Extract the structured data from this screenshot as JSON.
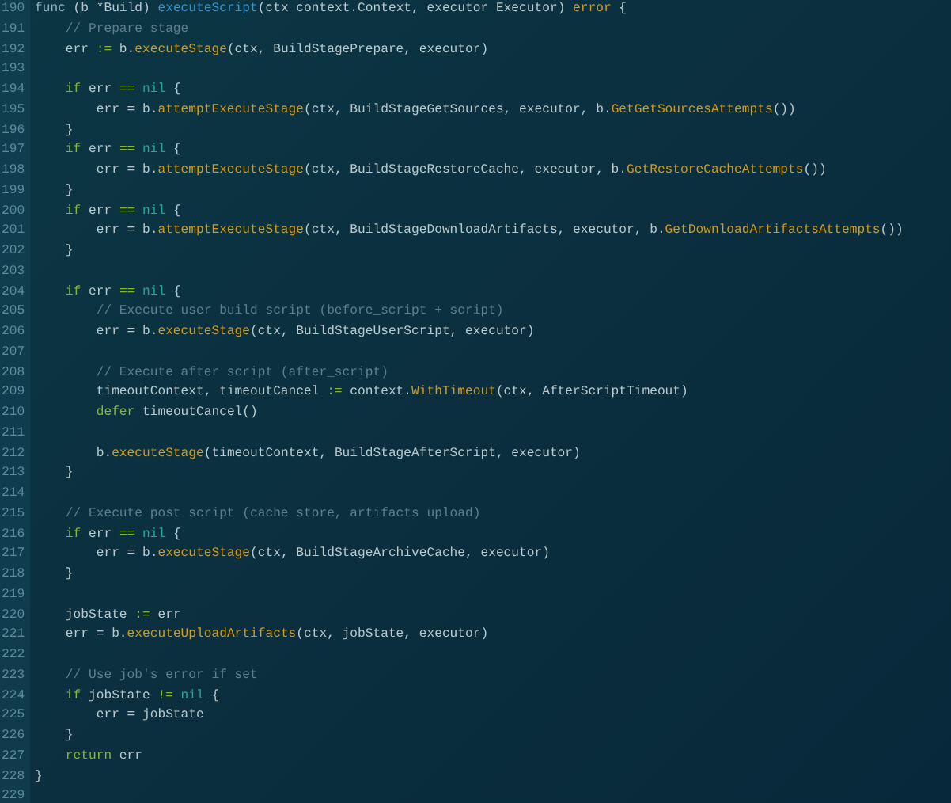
{
  "editor": {
    "lines": [
      {
        "number": "190",
        "tokens": [
          {
            "kind": "decl",
            "text": "func"
          },
          {
            "kind": "txt",
            "text": " (b *Build) "
          },
          {
            "kind": "def",
            "text": "executeScript"
          },
          {
            "kind": "txt",
            "text": "(ctx context.Context, executor Executor) "
          },
          {
            "kind": "type",
            "text": "error"
          },
          {
            "kind": "txt",
            "text": " {"
          }
        ]
      },
      {
        "number": "191",
        "tokens": [
          {
            "kind": "cmt",
            "text": "    // Prepare stage"
          }
        ]
      },
      {
        "number": "192",
        "tokens": [
          {
            "kind": "txt",
            "text": "    err "
          },
          {
            "kind": "op",
            "text": ":="
          },
          {
            "kind": "txt",
            "text": " b."
          },
          {
            "kind": "call",
            "text": "executeStage"
          },
          {
            "kind": "txt",
            "text": "(ctx, BuildStagePrepare, executor)"
          }
        ]
      },
      {
        "number": "193"
      },
      {
        "number": "194",
        "tokens": [
          {
            "kind": "kw",
            "text": "    if"
          },
          {
            "kind": "txt",
            "text": " err "
          },
          {
            "kind": "op",
            "text": "=="
          },
          {
            "kind": "nil",
            "text": " nil"
          },
          {
            "kind": "txt",
            "text": " {"
          }
        ]
      },
      {
        "number": "195",
        "tokens": [
          {
            "kind": "txt",
            "text": "        err = b."
          },
          {
            "kind": "call",
            "text": "attemptExecuteStage"
          },
          {
            "kind": "txt",
            "text": "(ctx, BuildStageGetSources, executor, b."
          },
          {
            "kind": "call",
            "text": "GetGetSourcesAttempts"
          },
          {
            "kind": "txt",
            "text": "())"
          }
        ]
      },
      {
        "number": "196",
        "tokens": [
          {
            "kind": "txt",
            "text": "    }"
          }
        ]
      },
      {
        "number": "197",
        "tokens": [
          {
            "kind": "kw",
            "text": "    if"
          },
          {
            "kind": "txt",
            "text": " err "
          },
          {
            "kind": "op",
            "text": "=="
          },
          {
            "kind": "nil",
            "text": " nil"
          },
          {
            "kind": "txt",
            "text": " {"
          }
        ]
      },
      {
        "number": "198",
        "tokens": [
          {
            "kind": "txt",
            "text": "        err = b."
          },
          {
            "kind": "call",
            "text": "attemptExecuteStage"
          },
          {
            "kind": "txt",
            "text": "(ctx, BuildStageRestoreCache, executor, b."
          },
          {
            "kind": "call",
            "text": "GetRestoreCacheAttempts"
          },
          {
            "kind": "txt",
            "text": "())"
          }
        ]
      },
      {
        "number": "199",
        "tokens": [
          {
            "kind": "txt",
            "text": "    }"
          }
        ]
      },
      {
        "number": "200",
        "tokens": [
          {
            "kind": "kw",
            "text": "    if"
          },
          {
            "kind": "txt",
            "text": " err "
          },
          {
            "kind": "op",
            "text": "=="
          },
          {
            "kind": "nil",
            "text": " nil"
          },
          {
            "kind": "txt",
            "text": " {"
          }
        ]
      },
      {
        "number": "201",
        "tokens": [
          {
            "kind": "txt",
            "text": "        err = b."
          },
          {
            "kind": "call",
            "text": "attemptExecuteStage"
          },
          {
            "kind": "txt",
            "text": "(ctx, BuildStageDownloadArtifacts, executor, b."
          },
          {
            "kind": "call",
            "text": "GetDownloadArtifactsAttempts"
          },
          {
            "kind": "txt",
            "text": "())"
          }
        ]
      },
      {
        "number": "202",
        "tokens": [
          {
            "kind": "txt",
            "text": "    }"
          }
        ]
      },
      {
        "number": "203"
      },
      {
        "number": "204",
        "tokens": [
          {
            "kind": "kw",
            "text": "    if"
          },
          {
            "kind": "txt",
            "text": " err "
          },
          {
            "kind": "op",
            "text": "=="
          },
          {
            "kind": "nil",
            "text": " nil"
          },
          {
            "kind": "txt",
            "text": " {"
          }
        ]
      },
      {
        "number": "205",
        "tokens": [
          {
            "kind": "cmt",
            "text": "        // Execute user build script (before_script + script)"
          }
        ]
      },
      {
        "number": "206",
        "tokens": [
          {
            "kind": "txt",
            "text": "        err = b."
          },
          {
            "kind": "call",
            "text": "executeStage"
          },
          {
            "kind": "txt",
            "text": "(ctx, BuildStageUserScript, executor)"
          }
        ]
      },
      {
        "number": "207"
      },
      {
        "number": "208",
        "tokens": [
          {
            "kind": "cmt",
            "text": "        // Execute after script (after_script)"
          }
        ]
      },
      {
        "number": "209",
        "tokens": [
          {
            "kind": "txt",
            "text": "        timeoutContext, timeoutCancel "
          },
          {
            "kind": "op",
            "text": ":="
          },
          {
            "kind": "txt",
            "text": " context."
          },
          {
            "kind": "call",
            "text": "WithTimeout"
          },
          {
            "kind": "txt",
            "text": "(ctx, AfterScriptTimeout)"
          }
        ]
      },
      {
        "number": "210",
        "tokens": [
          {
            "kind": "kw",
            "text": "        defer"
          },
          {
            "kind": "txt",
            "text": " timeoutCancel()"
          }
        ]
      },
      {
        "number": "211"
      },
      {
        "number": "212",
        "tokens": [
          {
            "kind": "txt",
            "text": "        b."
          },
          {
            "kind": "call",
            "text": "executeStage"
          },
          {
            "kind": "txt",
            "text": "(timeoutContext, BuildStageAfterScript, executor)"
          }
        ]
      },
      {
        "number": "213",
        "tokens": [
          {
            "kind": "txt",
            "text": "    }"
          }
        ]
      },
      {
        "number": "214"
      },
      {
        "number": "215",
        "tokens": [
          {
            "kind": "cmt",
            "text": "    // Execute post script (cache store, artifacts upload)"
          }
        ]
      },
      {
        "number": "216",
        "tokens": [
          {
            "kind": "kw",
            "text": "    if"
          },
          {
            "kind": "txt",
            "text": " err "
          },
          {
            "kind": "op",
            "text": "=="
          },
          {
            "kind": "nil",
            "text": " nil"
          },
          {
            "kind": "txt",
            "text": " {"
          }
        ]
      },
      {
        "number": "217",
        "tokens": [
          {
            "kind": "txt",
            "text": "        err = b."
          },
          {
            "kind": "call",
            "text": "executeStage"
          },
          {
            "kind": "txt",
            "text": "(ctx, BuildStageArchiveCache, executor)"
          }
        ]
      },
      {
        "number": "218",
        "tokens": [
          {
            "kind": "txt",
            "text": "    }"
          }
        ]
      },
      {
        "number": "219"
      },
      {
        "number": "220",
        "tokens": [
          {
            "kind": "txt",
            "text": "    jobState "
          },
          {
            "kind": "op",
            "text": ":="
          },
          {
            "kind": "txt",
            "text": " err"
          }
        ]
      },
      {
        "number": "221",
        "tokens": [
          {
            "kind": "txt",
            "text": "    err = b."
          },
          {
            "kind": "call",
            "text": "executeUploadArtifacts"
          },
          {
            "kind": "txt",
            "text": "(ctx, jobState, executor)"
          }
        ]
      },
      {
        "number": "222"
      },
      {
        "number": "223",
        "tokens": [
          {
            "kind": "cmt",
            "text": "    // Use job's error if set"
          }
        ]
      },
      {
        "number": "224",
        "tokens": [
          {
            "kind": "kw",
            "text": "    if"
          },
          {
            "kind": "txt",
            "text": " jobState "
          },
          {
            "kind": "op",
            "text": "!="
          },
          {
            "kind": "nil",
            "text": " nil"
          },
          {
            "kind": "txt",
            "text": " {"
          }
        ]
      },
      {
        "number": "225",
        "tokens": [
          {
            "kind": "txt",
            "text": "        err = jobState"
          }
        ]
      },
      {
        "number": "226",
        "tokens": [
          {
            "kind": "txt",
            "text": "    }"
          }
        ]
      },
      {
        "number": "227",
        "tokens": [
          {
            "kind": "kw",
            "text": "    return"
          },
          {
            "kind": "txt",
            "text": " err"
          }
        ]
      },
      {
        "number": "228",
        "tokens": [
          {
            "kind": "txt",
            "text": "}"
          }
        ]
      },
      {
        "number": "229"
      }
    ]
  }
}
